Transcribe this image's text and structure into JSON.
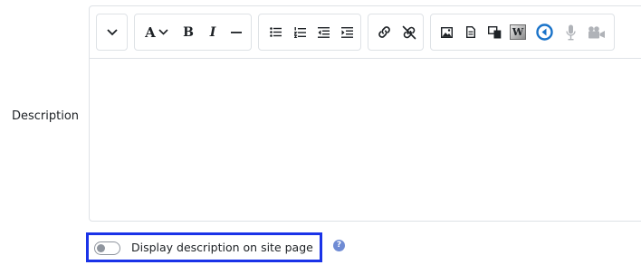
{
  "field": {
    "label": "Description"
  },
  "toolbar": {
    "groups": [
      {
        "name": "collapse",
        "buttons": [
          "chevron-down-icon"
        ]
      },
      {
        "name": "style",
        "buttons": [
          "font-style-icon",
          "bold-icon",
          "italic-icon",
          "horizontal-rule-icon"
        ]
      },
      {
        "name": "lists",
        "buttons": [
          "unordered-list-icon",
          "ordered-list-icon",
          "outdent-icon",
          "indent-icon"
        ]
      },
      {
        "name": "links",
        "buttons": [
          "link-icon",
          "unlink-icon"
        ]
      },
      {
        "name": "media",
        "buttons": [
          "image-icon",
          "media-file-icon",
          "manage-files-icon",
          "word-import-icon",
          "h5p-icon",
          "record-audio-icon",
          "record-video-icon"
        ]
      }
    ],
    "glyphs": {
      "font_style": "A",
      "bold": "B",
      "italic": "I",
      "word": "W"
    }
  },
  "editor": {
    "content": ""
  },
  "toggle": {
    "label": "Display description on site page",
    "checked": false
  },
  "help": {
    "glyph": "?"
  },
  "colors": {
    "highlight": "#1a33e8",
    "help": "#6f8bd4",
    "h5p": "#1a73c9",
    "disabled": "#b0b3b8"
  }
}
